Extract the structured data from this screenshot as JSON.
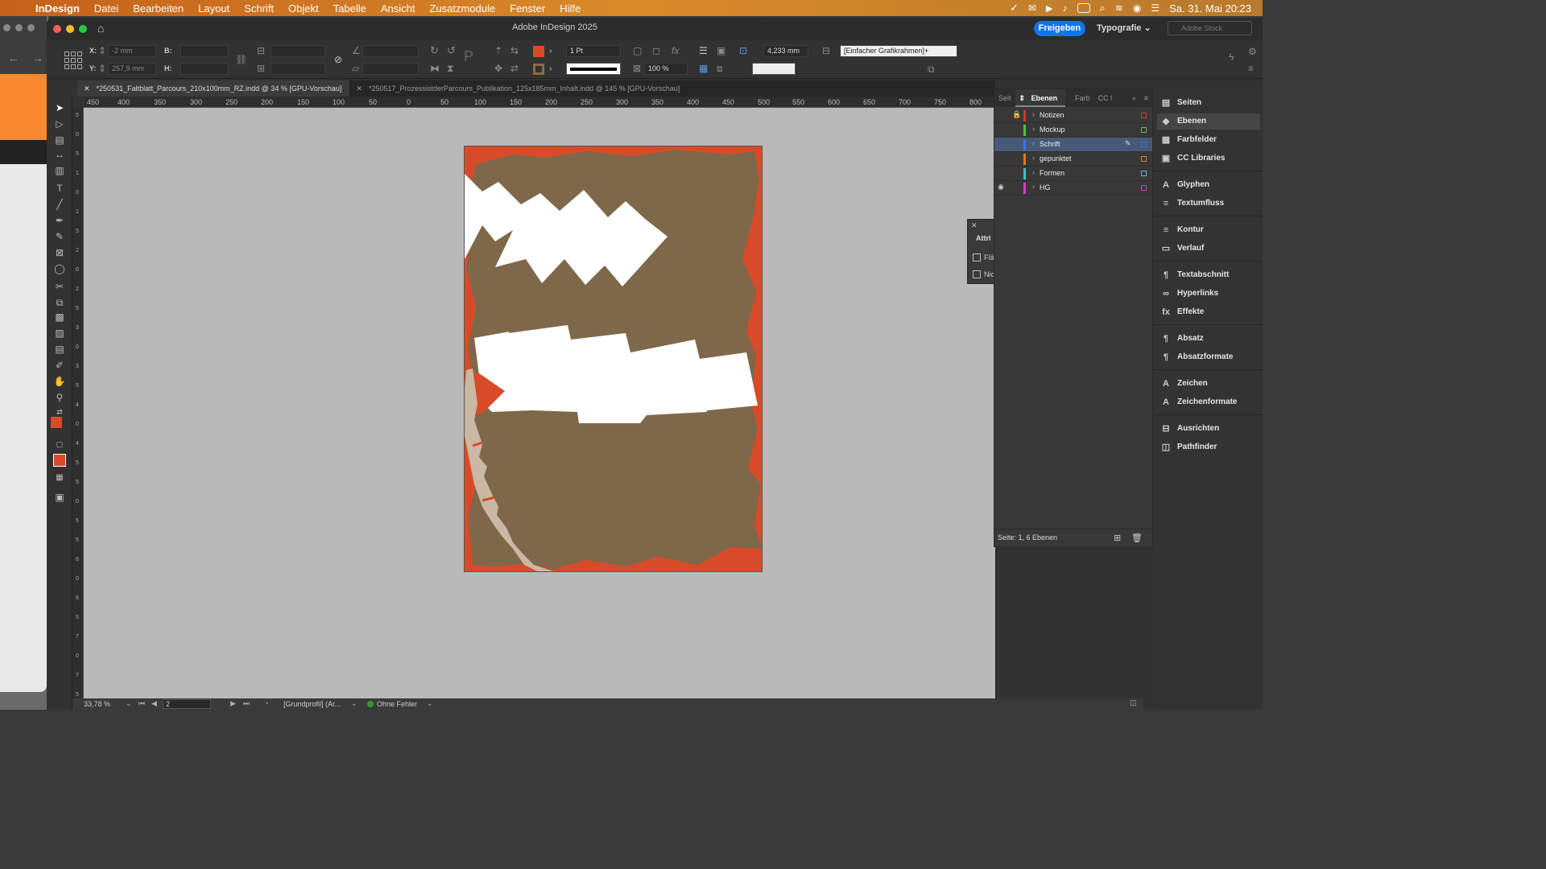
{
  "menubar": {
    "app": "InDesign",
    "items": [
      "Datei",
      "Bearbeiten",
      "Layout",
      "Schrift",
      "Objekt",
      "Tabelle",
      "Ansicht",
      "Zusatzmodule",
      "Fenster",
      "Hilfe"
    ],
    "clock": "Sa. 31. Mai  20:23"
  },
  "window": {
    "title": "Adobe InDesign 2025",
    "share_label": "Freigeben",
    "workspace_label": "Typografie",
    "stock_placeholder": "Adobe Stock"
  },
  "control": {
    "x_label": "X:",
    "x_value": "-2 mm",
    "y_label": "Y:",
    "y_value": "257,9 mm",
    "b_label": "B:",
    "h_label": "H:",
    "stroke_weight": "1 Pt",
    "opacity": "100 %",
    "offset": "4,233 mm",
    "object_style": "[Einfacher Grafikrahmen]+",
    "fill_color": "#d94a2a",
    "stroke_color": "#8a6a48"
  },
  "tabs": [
    {
      "label": "*250531_Faltblatt_Parcours_210x100mm_RZ.indd @ 34 % [GPU-Vorschau]",
      "active": true
    },
    {
      "label": "*250517_ProzessistderParcours_Publikation_125x185mm_Inhalt.indd @ 145 % [GPU-Vorschau]",
      "active": false
    }
  ],
  "ruler": {
    "h_ticks": [
      "450",
      "400",
      "350",
      "300",
      "250",
      "200",
      "150",
      "100",
      "50",
      "0",
      "50",
      "100",
      "150",
      "200",
      "250",
      "300",
      "350",
      "400",
      "450",
      "500",
      "550",
      "600",
      "650",
      "700",
      "750",
      "800"
    ]
  },
  "artwork": {
    "bg_color": "#d94b28",
    "brown_color": "#7f6849",
    "white_color": "#ffffff",
    "tan_color": "#c8b8a4"
  },
  "layers_panel": {
    "tabs": [
      "Seit",
      "Ebenen",
      "Farb",
      "CC l"
    ],
    "layers": [
      {
        "name": "Notizen",
        "color": "#e03030",
        "locked": true,
        "visible": false,
        "selected": false
      },
      {
        "name": "Mockup",
        "color": "#58c040",
        "locked": false,
        "visible": false,
        "selected": false
      },
      {
        "name": "Schrift",
        "color": "#3b70e0",
        "locked": false,
        "visible": false,
        "selected": true
      },
      {
        "name": "gepunktet",
        "color": "#e07828",
        "locked": false,
        "visible": false,
        "selected": false
      },
      {
        "name": "Formen",
        "color": "#36c8c8",
        "locked": false,
        "visible": false,
        "selected": false
      },
      {
        "name": "HG",
        "color": "#d040c0",
        "locked": false,
        "visible": true,
        "selected": false
      }
    ],
    "footer": "Seite: 1, 6 Ebenen"
  },
  "attributes_panel": {
    "title": "Attri",
    "items": [
      "Flä",
      "Nic"
    ]
  },
  "right_panel": {
    "items": [
      {
        "label": "Seiten",
        "icon": "pages-icon",
        "glyph": "▤"
      },
      {
        "label": "Ebenen",
        "icon": "layers-icon",
        "glyph": "◆"
      },
      {
        "label": "Farbfelder",
        "icon": "swatches-icon",
        "glyph": "▦"
      },
      {
        "label": "CC Libraries",
        "icon": "libraries-icon",
        "glyph": "▣"
      },
      {
        "label": "Glyphen",
        "icon": "glyphs-icon",
        "glyph": "A"
      },
      {
        "label": "Textumfluss",
        "icon": "text-wrap-icon",
        "glyph": "≡"
      },
      {
        "label": "Kontur",
        "icon": "stroke-icon",
        "glyph": "≡"
      },
      {
        "label": "Verlauf",
        "icon": "gradient-icon",
        "glyph": "▭"
      },
      {
        "label": "Textabschnitt",
        "icon": "story-icon",
        "glyph": "¶"
      },
      {
        "label": "Hyperlinks",
        "icon": "hyperlinks-icon",
        "glyph": "∞"
      },
      {
        "label": "Effekte",
        "icon": "effects-icon",
        "glyph": "fx"
      },
      {
        "label": "Absatz",
        "icon": "paragraph-icon",
        "glyph": "¶"
      },
      {
        "label": "Absatzformate",
        "icon": "paragraph-styles-icon",
        "glyph": "¶"
      },
      {
        "label": "Zeichen",
        "icon": "character-icon",
        "glyph": "A"
      },
      {
        "label": "Zeichenformate",
        "icon": "character-styles-icon",
        "glyph": "A"
      },
      {
        "label": "Ausrichten",
        "icon": "align-icon",
        "glyph": "⊟"
      },
      {
        "label": "Pathfinder",
        "icon": "pathfinder-icon",
        "glyph": "◫"
      }
    ]
  },
  "status": {
    "zoom": "33,78 %",
    "page": "2",
    "profile": "[Grundprofil] (Ar...",
    "preflight": "Ohne Fehler"
  }
}
